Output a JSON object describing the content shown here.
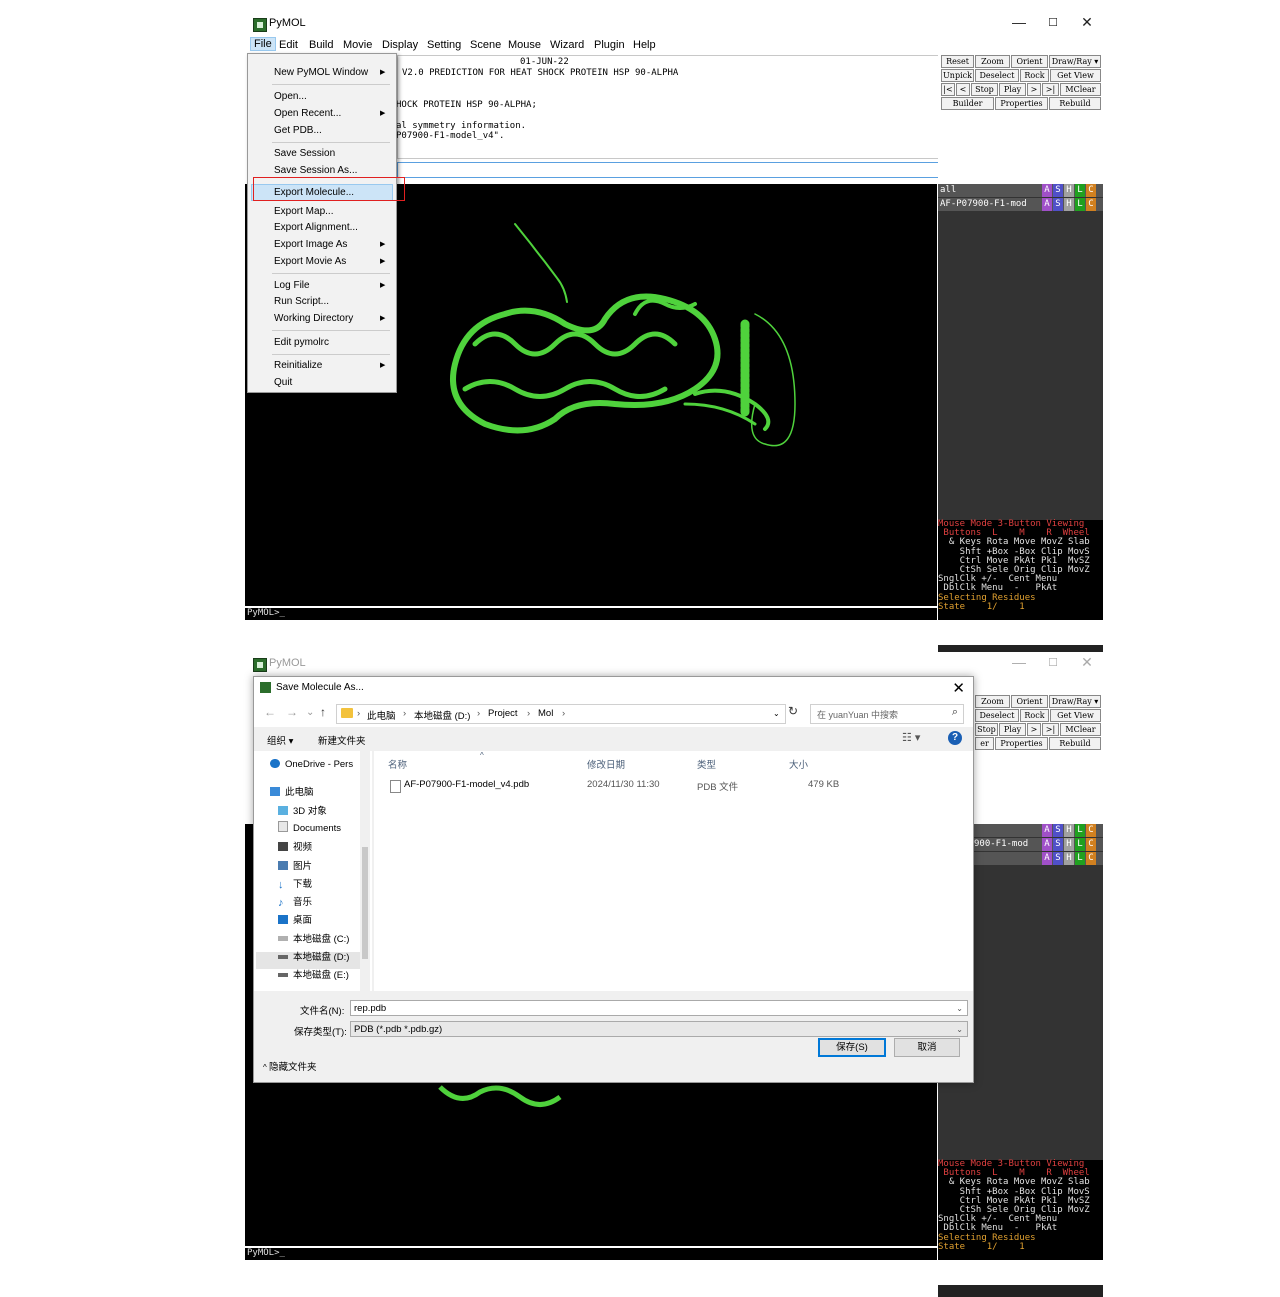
{
  "app": {
    "title": "PyMOL",
    "window_controls": {
      "minimize": "—",
      "maximize": "☐",
      "close": "✕"
    }
  },
  "menubar": [
    "File",
    "Edit",
    "Build",
    "Movie",
    "Display",
    "Setting",
    "Scene",
    "Mouse",
    "Wizard",
    "Plugin",
    "Help"
  ],
  "log": {
    "lines": [
      "01-JUN-22",
      "V2.0 PREDICTION FOR HEAT SHOCK PROTEIN HSP 90-ALPHA",
      "HOCK PROTEIN HSP 90-ALPHA;",
      "al symmetry information.",
      "P07900-F1-model_v4\"."
    ]
  },
  "prompt": "PyMOL>_",
  "file_menu": {
    "items": [
      {
        "label": "New PyMOL Window",
        "submenu": true
      },
      {
        "label": "Open...",
        "submenu": false
      },
      {
        "label": "Open Recent...",
        "submenu": true
      },
      {
        "label": "Get PDB...",
        "submenu": false
      },
      {
        "label": "Save Session",
        "submenu": false
      },
      {
        "label": "Save Session As...",
        "submenu": false
      },
      {
        "label": "Export Molecule...",
        "submenu": false,
        "highlighted": true
      },
      {
        "label": "Export Map...",
        "submenu": false
      },
      {
        "label": "Export Alignment...",
        "submenu": false
      },
      {
        "label": "Export Image As",
        "submenu": true
      },
      {
        "label": "Export Movie As",
        "submenu": true
      },
      {
        "label": "Log File",
        "submenu": true
      },
      {
        "label": "Run Script...",
        "submenu": false
      },
      {
        "label": "Working Directory",
        "submenu": true
      },
      {
        "label": "Edit pymolrc",
        "submenu": false
      },
      {
        "label": "Reinitialize",
        "submenu": true
      },
      {
        "label": "Quit",
        "submenu": false
      }
    ],
    "arrow": "▶"
  },
  "toolbar": {
    "row1": [
      "Reset",
      "Zoom",
      "Orient",
      "Draw/Ray ▾"
    ],
    "row2": [
      "Unpick",
      "Deselect",
      "Rock",
      "Get View"
    ],
    "row3": [
      "|<",
      "<",
      "Stop",
      "Play",
      ">",
      ">|",
      "MClear"
    ],
    "row4": [
      "Builder",
      "Properties",
      "Rebuild"
    ]
  },
  "toolbar2": {
    "row1": [
      "Zoom",
      "Orient",
      "Draw/Ray ▾"
    ],
    "row2": [
      "Deselect",
      "Rock",
      "Get View"
    ],
    "row3": [
      "Stop",
      "Play",
      ">",
      ">|",
      "MClear"
    ],
    "row4": [
      "er",
      "Properties",
      "Rebuild"
    ]
  },
  "objects": [
    {
      "name": "all"
    },
    {
      "name": "AF-P07900-F1-mod"
    }
  ],
  "objects2": [
    {
      "name": ""
    },
    {
      "name": "900-F1-mod"
    },
    {
      "name": ""
    }
  ],
  "object_buttons": [
    {
      "letter": "A",
      "color": "#a050c8"
    },
    {
      "letter": "S",
      "color": "#5050c8"
    },
    {
      "letter": "H",
      "color": "#a0a0a0"
    },
    {
      "letter": "L",
      "color": "#20a020"
    },
    {
      "letter": "C",
      "color": "#d08020"
    }
  ],
  "mouse_panel": [
    {
      "text": "Mouse Mode 3-Button Viewing",
      "color": "#e04040"
    },
    {
      "text": " Buttons  L    M    R  Wheel",
      "color": "#e04040"
    },
    {
      "text": "  & Keys Rota Move MovZ Slab",
      "color": "#e0e0e0"
    },
    {
      "text": "    Shft +Box -Box Clip MovS",
      "color": "#e0e0e0"
    },
    {
      "text": "    Ctrl Move PkAt Pk1  MvSZ",
      "color": "#e0e0e0"
    },
    {
      "text": "    CtSh Sele Orig Clip MovZ",
      "color": "#e0e0e0"
    },
    {
      "text": "SnglClk +/-  Cent Menu",
      "color": "#e0e0e0"
    },
    {
      "text": " DblClk Menu  -   PkAt",
      "color": "#e0e0e0"
    },
    {
      "text": "Selecting Residues",
      "color": "#e0a030"
    },
    {
      "text": "State    1/    1",
      "color": "#e0a030"
    }
  ],
  "dialog": {
    "title": "Save Molecule As...",
    "breadcrumbs": [
      "此电脑",
      "本地磁盘 (D:)",
      "Project",
      "Mol"
    ],
    "search_placeholder": "在 yuanYuan 中搜索",
    "organize": "组织 ▾",
    "new_folder": "新建文件夹",
    "tree": [
      {
        "label": "OneDrive - Pers",
        "icon": "cloud-icon"
      },
      {
        "label": "此电脑",
        "icon": "computer-icon"
      },
      {
        "label": "3D 对象",
        "icon": "cube-icon"
      },
      {
        "label": "Documents",
        "icon": "document-icon"
      },
      {
        "label": "视频",
        "icon": "video-icon"
      },
      {
        "label": "图片",
        "icon": "picture-icon"
      },
      {
        "label": "下载",
        "icon": "download-icon"
      },
      {
        "label": "音乐",
        "icon": "music-icon"
      },
      {
        "label": "桌面",
        "icon": "desktop-icon"
      },
      {
        "label": "本地磁盘 (C:)",
        "icon": "drive-icon"
      },
      {
        "label": "本地磁盘 (D:)",
        "icon": "drive-icon",
        "selected": true
      },
      {
        "label": "本地磁盘 (E:)",
        "icon": "drive-icon"
      }
    ],
    "columns": [
      "名称",
      "修改日期",
      "类型",
      "大小"
    ],
    "files": [
      {
        "name": "AF-P07900-F1-model_v4.pdb",
        "date": "2024/11/30 11:30",
        "type": "PDB 文件",
        "size": "479 KB"
      }
    ],
    "filename_label": "文件名(N):",
    "filename_value": "rep.pdb",
    "filetype_label": "保存类型(T):",
    "filetype_value": "PDB (*.pdb *.pdb.gz)",
    "hide_folders": "隐藏文件夹",
    "save": "保存(S)",
    "cancel": "取消"
  },
  "colors": {
    "protein": "#4fd23c",
    "highlight": "#cce4f7",
    "red_box": "#e02020",
    "accent": "#0078d7"
  }
}
